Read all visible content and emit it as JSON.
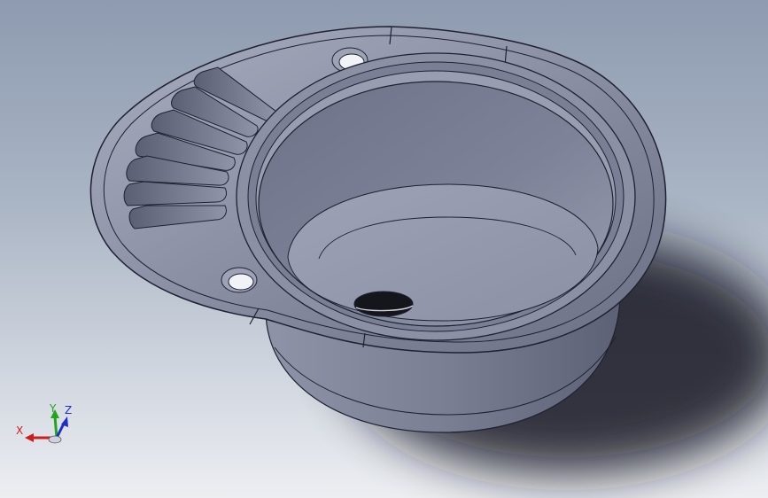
{
  "viewport": {
    "model": "sink-model",
    "colors": {
      "background_top": "#8e9bb0",
      "background_bottom": "#eceef2",
      "surface": "#7c8096",
      "surface_light": "#a6aabd",
      "edge": "#1e2130",
      "shadow": "#161820"
    }
  },
  "triad": {
    "x_label": "X",
    "y_label": "Y",
    "z_label": "Z",
    "colors": {
      "x": "#cc1e1e",
      "y": "#1fa51f",
      "z": "#1e2fc8"
    }
  }
}
